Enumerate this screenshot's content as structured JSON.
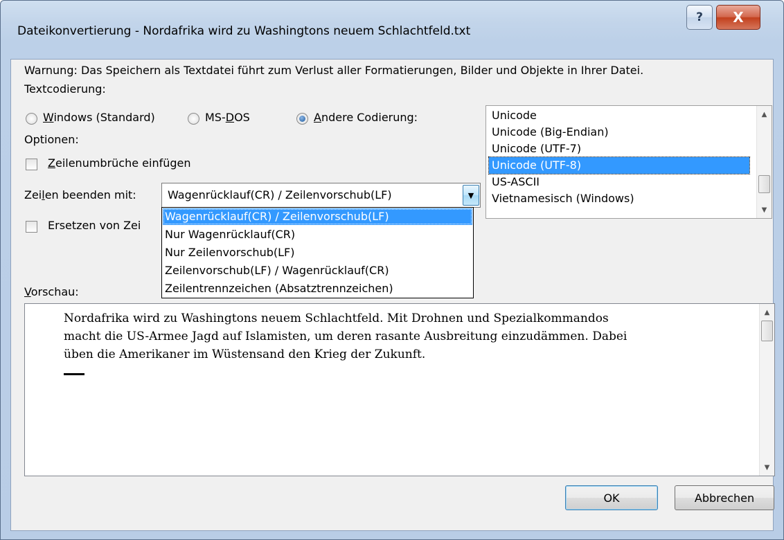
{
  "window": {
    "title": "Dateikonvertierung - Nordafrika wird zu Washingtons neuem Schlachtfeld.txt",
    "help_glyph": "?",
    "close_glyph": "X"
  },
  "warning": "Warnung: Das Speichern als Textdatei führt zum Verlust aller Formatierungen, Bilder und Objekte in Ihrer Datei.",
  "encoding": {
    "label": "Textcodierung:",
    "options": [
      {
        "pre": "",
        "key": "W",
        "post": "indows (Standard)",
        "selected": false
      },
      {
        "pre": "MS-",
        "key": "D",
        "post": "OS",
        "selected": false
      },
      {
        "pre": "",
        "key": "A",
        "post": "ndere Codierung:",
        "selected": true
      }
    ],
    "list": {
      "items": [
        "Unicode",
        "Unicode (Big-Endian)",
        "Unicode (UTF-7)",
        "Unicode (UTF-8)",
        "US-ASCII",
        "Vietnamesisch (Windows)"
      ],
      "selected_index": 3,
      "scroll_fraction": 0.85
    }
  },
  "options": {
    "label": "Optionen:",
    "wrap": {
      "key": "Z",
      "post": "eilenumbrüche einfügen",
      "checked": false
    },
    "replace": {
      "text": "Ersetzen von Zei",
      "checked": false
    }
  },
  "line_end": {
    "label_pre": "Zei",
    "label_key": "l",
    "label_post": "en beenden mit:",
    "value": "Wagenrücklauf(CR) / Zeilenvorschub(LF)",
    "dropdown_arrow": "▼",
    "options": [
      "Wagenrücklauf(CR) / Zeilenvorschub(LF)",
      "Nur Wagenrücklauf(CR)",
      "Nur Zeilenvorschub(LF)",
      "Zeilenvorschub(LF) / Wagenrücklauf(CR)",
      "Zeilentrennzeichen (Absatztrennzeichen)"
    ],
    "selected_index": 0
  },
  "preview": {
    "label_key": "V",
    "label_post": "orschau:",
    "lines": [
      "Nordafrika wird zu Washingtons neuem Schlachtfeld. Mit Drohnen und Spezialkommandos",
      "macht die US-Armee Jagd auf Islamisten, um deren rasante Ausbreitung einzudämmen. Dabei",
      "üben die Amerikaner im Wüstensand den Krieg der Zukunft."
    ],
    "scroll_fraction": 0.0
  },
  "buttons": {
    "ok": "OK",
    "cancel": "Abbrechen"
  },
  "icons": {
    "scroll_up": "▲",
    "scroll_down": "▼"
  }
}
